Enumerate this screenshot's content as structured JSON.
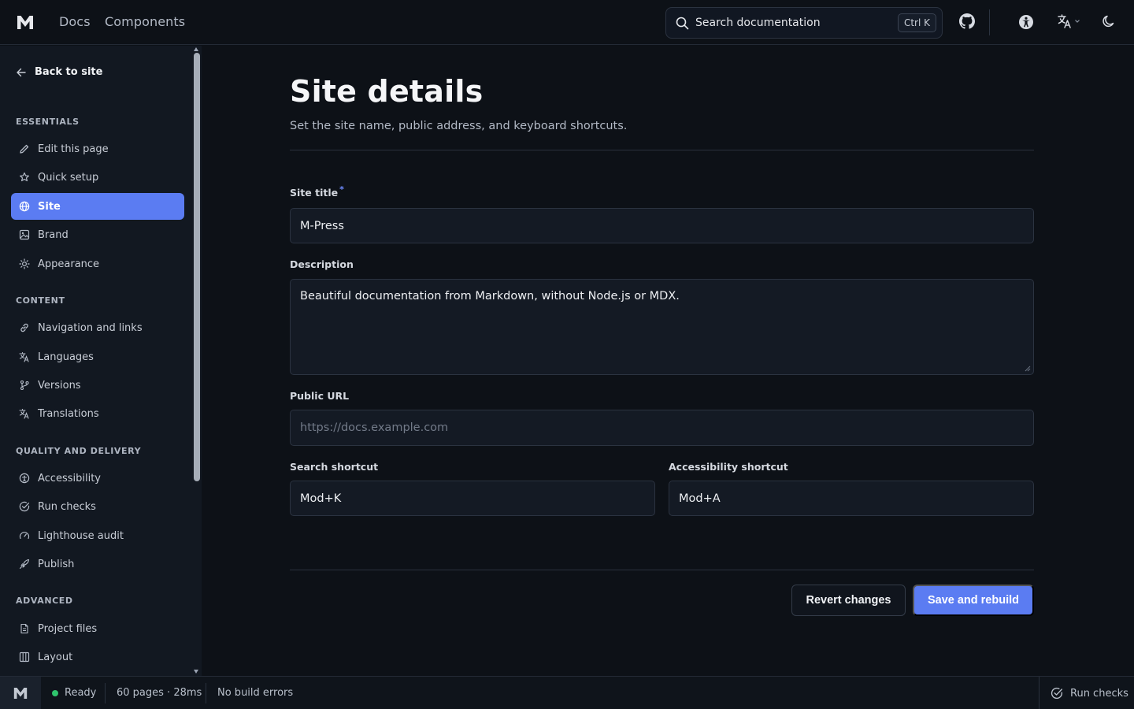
{
  "header": {
    "nav": [
      "Docs",
      "Components"
    ],
    "search_placeholder": "Search documentation",
    "search_shortcut": "Ctrl K",
    "icons": [
      "github-icon",
      "accessibility-icon",
      "language-icon",
      "moon-icon"
    ]
  },
  "sidebar": {
    "back": "Back to site",
    "sections": {
      "essentials": "ESSENTIALS",
      "content": "CONTENT",
      "quality": "QUALITY AND DELIVERY",
      "advanced": "ADVANCED"
    },
    "items": {
      "edit": "Edit this page",
      "quick": "Quick setup",
      "site": "Site",
      "brand": "Brand",
      "appearance": "Appearance",
      "navigation": "Navigation and links",
      "languages": "Languages",
      "versions": "Versions",
      "translations": "Translations",
      "accessibility": "Accessibility",
      "run_checks": "Run checks",
      "lighthouse": "Lighthouse audit",
      "publish": "Publish",
      "project_files": "Project files",
      "layout": "Layout"
    }
  },
  "main": {
    "title": "Site details",
    "subtitle": "Set the site name, public address, and keyboard shortcuts.",
    "fields": {
      "site_title": {
        "label": "Site title",
        "required_mark": "*",
        "value": "M-Press"
      },
      "description": {
        "label": "Description",
        "value": "Beautiful documentation from Markdown, without Node.js or MDX."
      },
      "public_url": {
        "label": "Public URL",
        "placeholder": "https://docs.example.com"
      },
      "search_shortcut": {
        "label": "Search shortcut",
        "value": "Mod+K"
      },
      "a11y_shortcut": {
        "label": "Accessibility shortcut",
        "value": "Mod+A"
      }
    },
    "buttons": {
      "revert": "Revert changes",
      "save": "Save and rebuild"
    }
  },
  "status": {
    "state": "Ready",
    "pages": "60 pages · 28ms",
    "errors": "No build errors",
    "run_checks": "Run checks"
  },
  "colors": {
    "accent": "#5b7cf2",
    "background": "#0d1117",
    "sidebar": "#121821",
    "ready_dot": "#2fc46d"
  }
}
